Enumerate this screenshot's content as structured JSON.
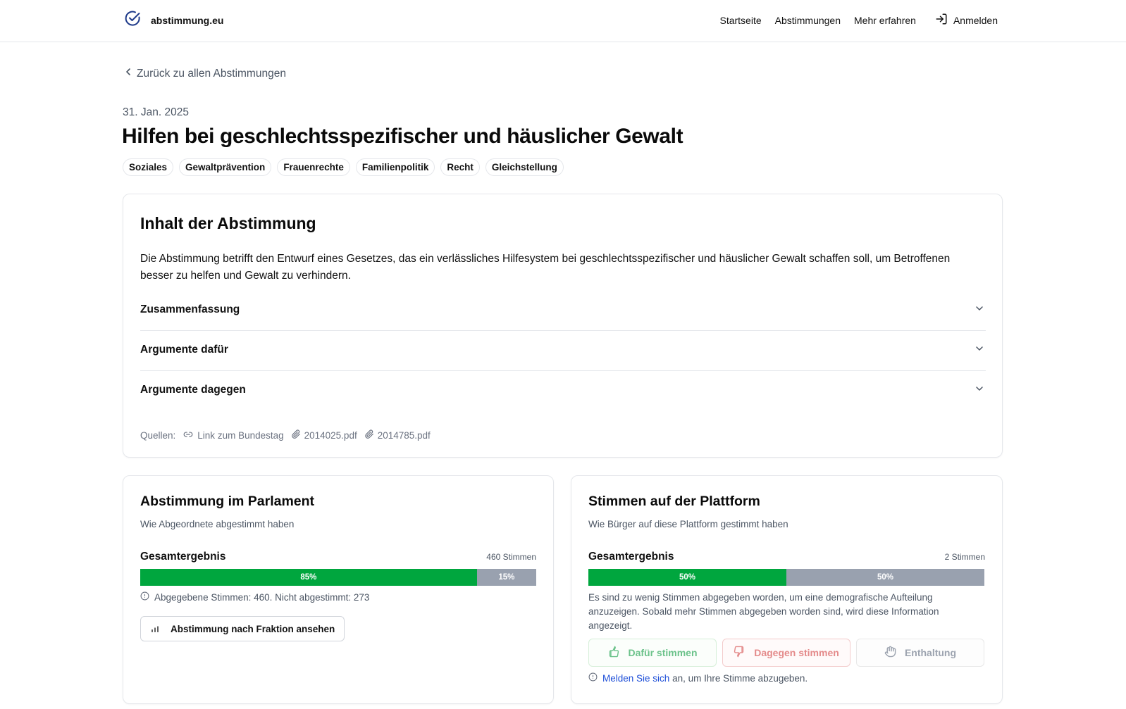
{
  "header": {
    "brand": "abstimmung.eu",
    "nav": [
      "Startseite",
      "Abstimmungen",
      "Mehr erfahren"
    ],
    "login_label": "Anmelden",
    "icons": {
      "brand": "check-circle-icon",
      "login": "login-icon"
    }
  },
  "back_link": "Zurück zu allen Abstimmungen",
  "date": "31. Jan. 2025",
  "title": "Hilfen bei geschlechtsspezifischer und häuslicher Gewalt",
  "tags": [
    "Soziales",
    "Gewaltprävention",
    "Frauenrechte",
    "Familienpolitik",
    "Recht",
    "Gleichstellung"
  ],
  "content": {
    "title": "Inhalt der Abstimmung",
    "description": "Die Abstimmung betrifft den Entwurf eines Gesetzes, das ein verlässliches Hilfesystem bei geschlechtsspezifischer und häuslicher Gewalt schaffen soll, um Betroffenen besser zu helfen und Gewalt zu verhindern.",
    "accordions": [
      "Zusammenfassung",
      "Argumente dafür",
      "Argumente dagegen"
    ],
    "sources_label": "Quellen:",
    "sources": [
      "Link zum Bundestag",
      "2014025.pdf",
      "2014785.pdf"
    ]
  },
  "parliament": {
    "title": "Abstimmung im Parlament",
    "subtitle": "Wie Abgeordnete abgestimmt haben",
    "result_label": "Gesamtergebnis",
    "votes_count": "460 Stimmen",
    "yes_percent": 85,
    "no_percent": 15,
    "yes_label": "85%",
    "no_label": "15%",
    "info": "Abgegebene Stimmen: 460. Nicht abgestimmt: 273",
    "fraction_button": "Abstimmung nach Fraktion ansehen"
  },
  "platform": {
    "title": "Stimmen auf der Plattform",
    "subtitle": "Wie Bürger auf diese Plattform gestimmt haben",
    "result_label": "Gesamtergebnis",
    "votes_count": "2 Stimmen",
    "yes_percent": 50,
    "no_percent": 50,
    "yes_label": "50%",
    "no_label": "50%",
    "note": "Es sind zu wenig Stimmen abgegeben worden, um eine demografische Aufteilung anzuzeigen. Sobald mehr Stimmen abgegeben worden sind, wird diese Information angezeigt.",
    "vote_yes": "Dafür stimmen",
    "vote_no": "Dagegen stimmen",
    "vote_abstain": "Enthaltung",
    "login_link": "Melden Sie sich",
    "login_rest": " an, um Ihre Stimme abzugeben."
  },
  "colors": {
    "yes": "#00a63e",
    "no": "#99a1af",
    "brand": "#1e3a8a",
    "link": "#1d4ed8"
  }
}
